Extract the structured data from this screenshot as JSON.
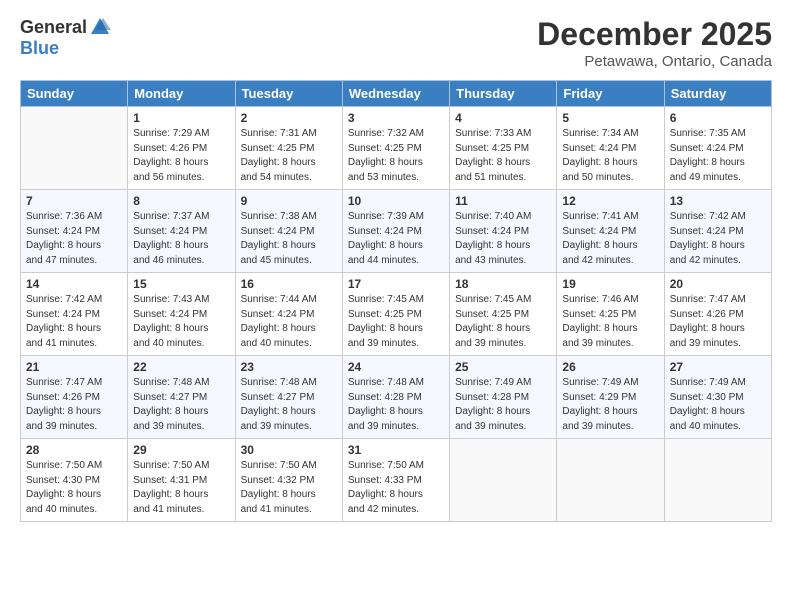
{
  "logo": {
    "general": "General",
    "blue": "Blue"
  },
  "title": "December 2025",
  "subtitle": "Petawawa, Ontario, Canada",
  "days_header": [
    "Sunday",
    "Monday",
    "Tuesday",
    "Wednesday",
    "Thursday",
    "Friday",
    "Saturday"
  ],
  "weeks": [
    [
      {
        "day": "",
        "info": ""
      },
      {
        "day": "1",
        "info": "Sunrise: 7:29 AM\nSunset: 4:26 PM\nDaylight: 8 hours\nand 56 minutes."
      },
      {
        "day": "2",
        "info": "Sunrise: 7:31 AM\nSunset: 4:25 PM\nDaylight: 8 hours\nand 54 minutes."
      },
      {
        "day": "3",
        "info": "Sunrise: 7:32 AM\nSunset: 4:25 PM\nDaylight: 8 hours\nand 53 minutes."
      },
      {
        "day": "4",
        "info": "Sunrise: 7:33 AM\nSunset: 4:25 PM\nDaylight: 8 hours\nand 51 minutes."
      },
      {
        "day": "5",
        "info": "Sunrise: 7:34 AM\nSunset: 4:24 PM\nDaylight: 8 hours\nand 50 minutes."
      },
      {
        "day": "6",
        "info": "Sunrise: 7:35 AM\nSunset: 4:24 PM\nDaylight: 8 hours\nand 49 minutes."
      }
    ],
    [
      {
        "day": "7",
        "info": "Sunrise: 7:36 AM\nSunset: 4:24 PM\nDaylight: 8 hours\nand 47 minutes."
      },
      {
        "day": "8",
        "info": "Sunrise: 7:37 AM\nSunset: 4:24 PM\nDaylight: 8 hours\nand 46 minutes."
      },
      {
        "day": "9",
        "info": "Sunrise: 7:38 AM\nSunset: 4:24 PM\nDaylight: 8 hours\nand 45 minutes."
      },
      {
        "day": "10",
        "info": "Sunrise: 7:39 AM\nSunset: 4:24 PM\nDaylight: 8 hours\nand 44 minutes."
      },
      {
        "day": "11",
        "info": "Sunrise: 7:40 AM\nSunset: 4:24 PM\nDaylight: 8 hours\nand 43 minutes."
      },
      {
        "day": "12",
        "info": "Sunrise: 7:41 AM\nSunset: 4:24 PM\nDaylight: 8 hours\nand 42 minutes."
      },
      {
        "day": "13",
        "info": "Sunrise: 7:42 AM\nSunset: 4:24 PM\nDaylight: 8 hours\nand 42 minutes."
      }
    ],
    [
      {
        "day": "14",
        "info": "Sunrise: 7:42 AM\nSunset: 4:24 PM\nDaylight: 8 hours\nand 41 minutes."
      },
      {
        "day": "15",
        "info": "Sunrise: 7:43 AM\nSunset: 4:24 PM\nDaylight: 8 hours\nand 40 minutes."
      },
      {
        "day": "16",
        "info": "Sunrise: 7:44 AM\nSunset: 4:24 PM\nDaylight: 8 hours\nand 40 minutes."
      },
      {
        "day": "17",
        "info": "Sunrise: 7:45 AM\nSunset: 4:25 PM\nDaylight: 8 hours\nand 39 minutes."
      },
      {
        "day": "18",
        "info": "Sunrise: 7:45 AM\nSunset: 4:25 PM\nDaylight: 8 hours\nand 39 minutes."
      },
      {
        "day": "19",
        "info": "Sunrise: 7:46 AM\nSunset: 4:25 PM\nDaylight: 8 hours\nand 39 minutes."
      },
      {
        "day": "20",
        "info": "Sunrise: 7:47 AM\nSunset: 4:26 PM\nDaylight: 8 hours\nand 39 minutes."
      }
    ],
    [
      {
        "day": "21",
        "info": "Sunrise: 7:47 AM\nSunset: 4:26 PM\nDaylight: 8 hours\nand 39 minutes."
      },
      {
        "day": "22",
        "info": "Sunrise: 7:48 AM\nSunset: 4:27 PM\nDaylight: 8 hours\nand 39 minutes."
      },
      {
        "day": "23",
        "info": "Sunrise: 7:48 AM\nSunset: 4:27 PM\nDaylight: 8 hours\nand 39 minutes."
      },
      {
        "day": "24",
        "info": "Sunrise: 7:48 AM\nSunset: 4:28 PM\nDaylight: 8 hours\nand 39 minutes."
      },
      {
        "day": "25",
        "info": "Sunrise: 7:49 AM\nSunset: 4:28 PM\nDaylight: 8 hours\nand 39 minutes."
      },
      {
        "day": "26",
        "info": "Sunrise: 7:49 AM\nSunset: 4:29 PM\nDaylight: 8 hours\nand 39 minutes."
      },
      {
        "day": "27",
        "info": "Sunrise: 7:49 AM\nSunset: 4:30 PM\nDaylight: 8 hours\nand 40 minutes."
      }
    ],
    [
      {
        "day": "28",
        "info": "Sunrise: 7:50 AM\nSunset: 4:30 PM\nDaylight: 8 hours\nand 40 minutes."
      },
      {
        "day": "29",
        "info": "Sunrise: 7:50 AM\nSunset: 4:31 PM\nDaylight: 8 hours\nand 41 minutes."
      },
      {
        "day": "30",
        "info": "Sunrise: 7:50 AM\nSunset: 4:32 PM\nDaylight: 8 hours\nand 41 minutes."
      },
      {
        "day": "31",
        "info": "Sunrise: 7:50 AM\nSunset: 4:33 PM\nDaylight: 8 hours\nand 42 minutes."
      },
      {
        "day": "",
        "info": ""
      },
      {
        "day": "",
        "info": ""
      },
      {
        "day": "",
        "info": ""
      }
    ]
  ]
}
